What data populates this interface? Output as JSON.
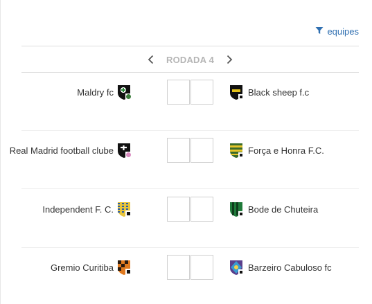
{
  "filter": {
    "label": "equipes",
    "icon": "filter-icon"
  },
  "round": {
    "label": "RODADA 4",
    "prev_icon": "chevron-left-icon",
    "next_icon": "chevron-right-icon"
  },
  "matches": [
    {
      "home": {
        "name": "Maldry fc",
        "crest": "shield-crest-icon"
      },
      "away": {
        "name": "Black sheep f.c",
        "crest": "shield-crest-icon"
      }
    },
    {
      "home": {
        "name": "Real Madrid football clube",
        "crest": "shield-crest-icon"
      },
      "away": {
        "name": "Força e Honra F.C.",
        "crest": "shield-crest-icon"
      }
    },
    {
      "home": {
        "name": "Independent F. C.",
        "crest": "shield-crest-icon"
      },
      "away": {
        "name": "Bode de Chuteira",
        "crest": "shield-crest-icon"
      }
    },
    {
      "home": {
        "name": "Gremio Curitiba",
        "crest": "shield-crest-icon"
      },
      "away": {
        "name": "Barzeiro Cabuloso fc",
        "crest": "shield-crest-icon"
      }
    }
  ],
  "colors": {
    "accent": "#2f6fb1",
    "muted": "#b5b5b5"
  }
}
